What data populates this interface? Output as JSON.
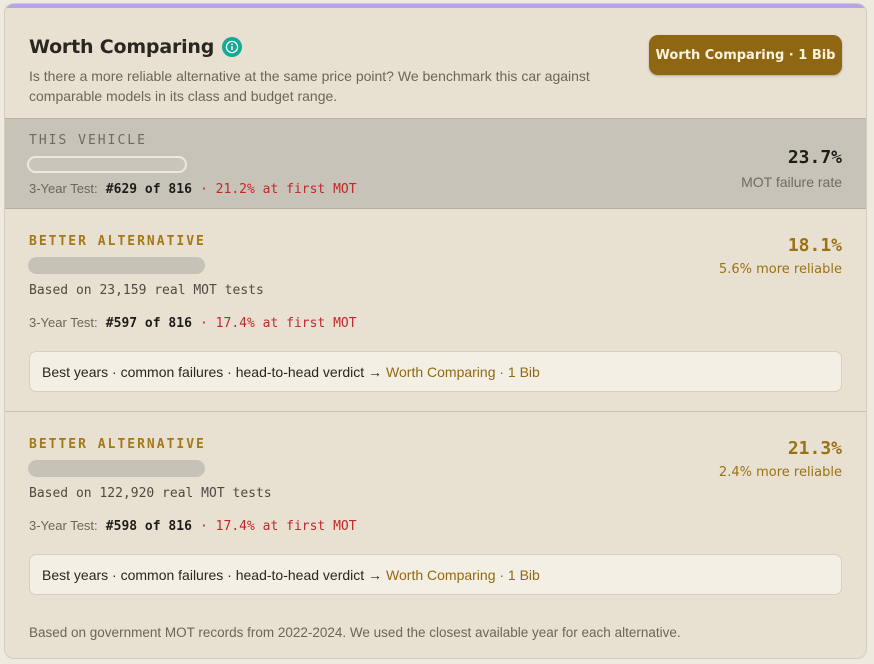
{
  "header": {
    "title": "Worth Comparing",
    "subtitle": "Is there a more reliable alternative at the same price point? We benchmark this car against comparable models in its class and budget range.",
    "cta_label": "Worth Comparing · 1 Bib"
  },
  "this_vehicle": {
    "label": "THIS VEHICLE",
    "test_prefix": "3-Year Test:",
    "rank": "#629 of 816",
    "first_mot": "· 21.2% at first MOT",
    "failure_rate": "23.7%",
    "failure_rate_label": "MOT failure rate"
  },
  "alternatives": [
    {
      "label": "BETTER ALTERNATIVE",
      "based_on": "Based on 23,159 real MOT tests",
      "test_prefix": "3-Year Test:",
      "rank": "#597 of 816",
      "first_mot": "· 17.4% at first MOT",
      "failure_rate": "18.1%",
      "reliability_note": "5.6% more reliable",
      "teaser_text": "Best years · common failures · head-to-head verdict →",
      "teaser_link": "Worth Comparing · 1 Bib"
    },
    {
      "label": "BETTER ALTERNATIVE",
      "based_on": "Based on 122,920 real MOT tests",
      "test_prefix": "3-Year Test:",
      "rank": "#598 of 816",
      "first_mot": "· 17.4% at first MOT",
      "failure_rate": "21.3%",
      "reliability_note": "2.4% more reliable",
      "teaser_text": "Best years · common failures · head-to-head verdict →",
      "teaser_link": "Worth Comparing · 1 Bib"
    }
  ],
  "footnote": "Based on government MOT records from 2022-2024. We used the closest available year for each alternative.",
  "icons": {
    "info": "info-icon"
  },
  "colors": {
    "accent": "#8f6712",
    "gold_text": "#9a7214",
    "fail_red": "#c0282a",
    "info_teal": "#16a896"
  }
}
